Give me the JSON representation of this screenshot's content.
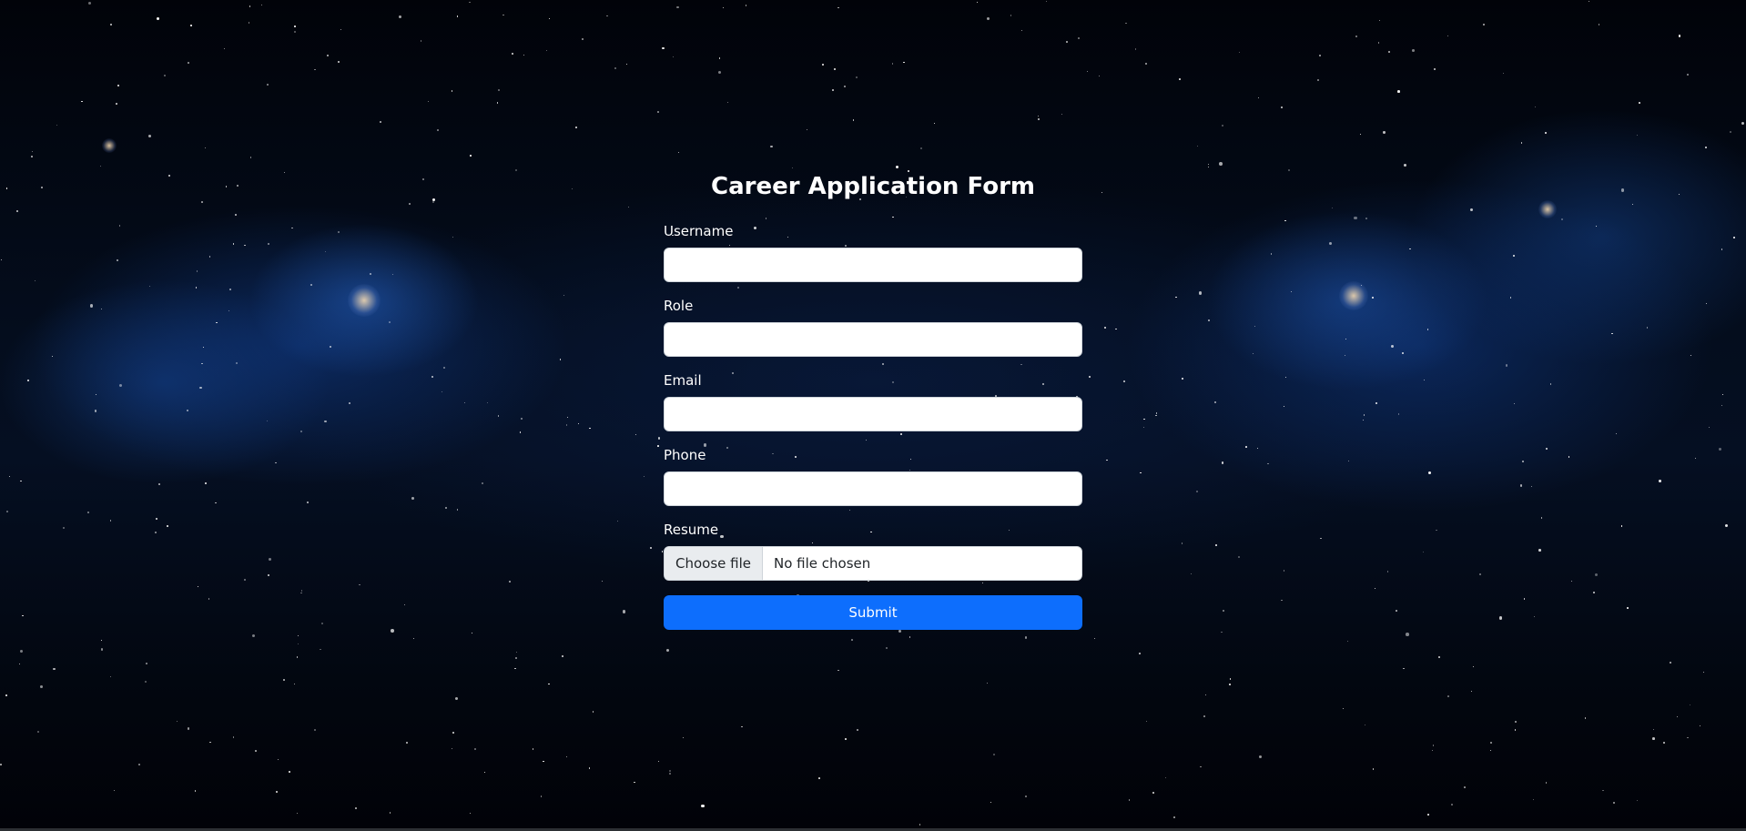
{
  "form": {
    "title": "Career Application Form",
    "fields": [
      {
        "label": "Username",
        "value": "",
        "placeholder": ""
      },
      {
        "label": "Role",
        "value": "",
        "placeholder": ""
      },
      {
        "label": "Email",
        "value": "",
        "placeholder": ""
      },
      {
        "label": "Phone",
        "value": "",
        "placeholder": ""
      }
    ],
    "resume": {
      "label": "Resume",
      "button_label": "Choose file",
      "status_text": "No file chosen"
    },
    "submit_label": "Submit"
  },
  "colors": {
    "accent": "#0d6efd",
    "text_light": "#ffffff",
    "background": "#02050b"
  }
}
